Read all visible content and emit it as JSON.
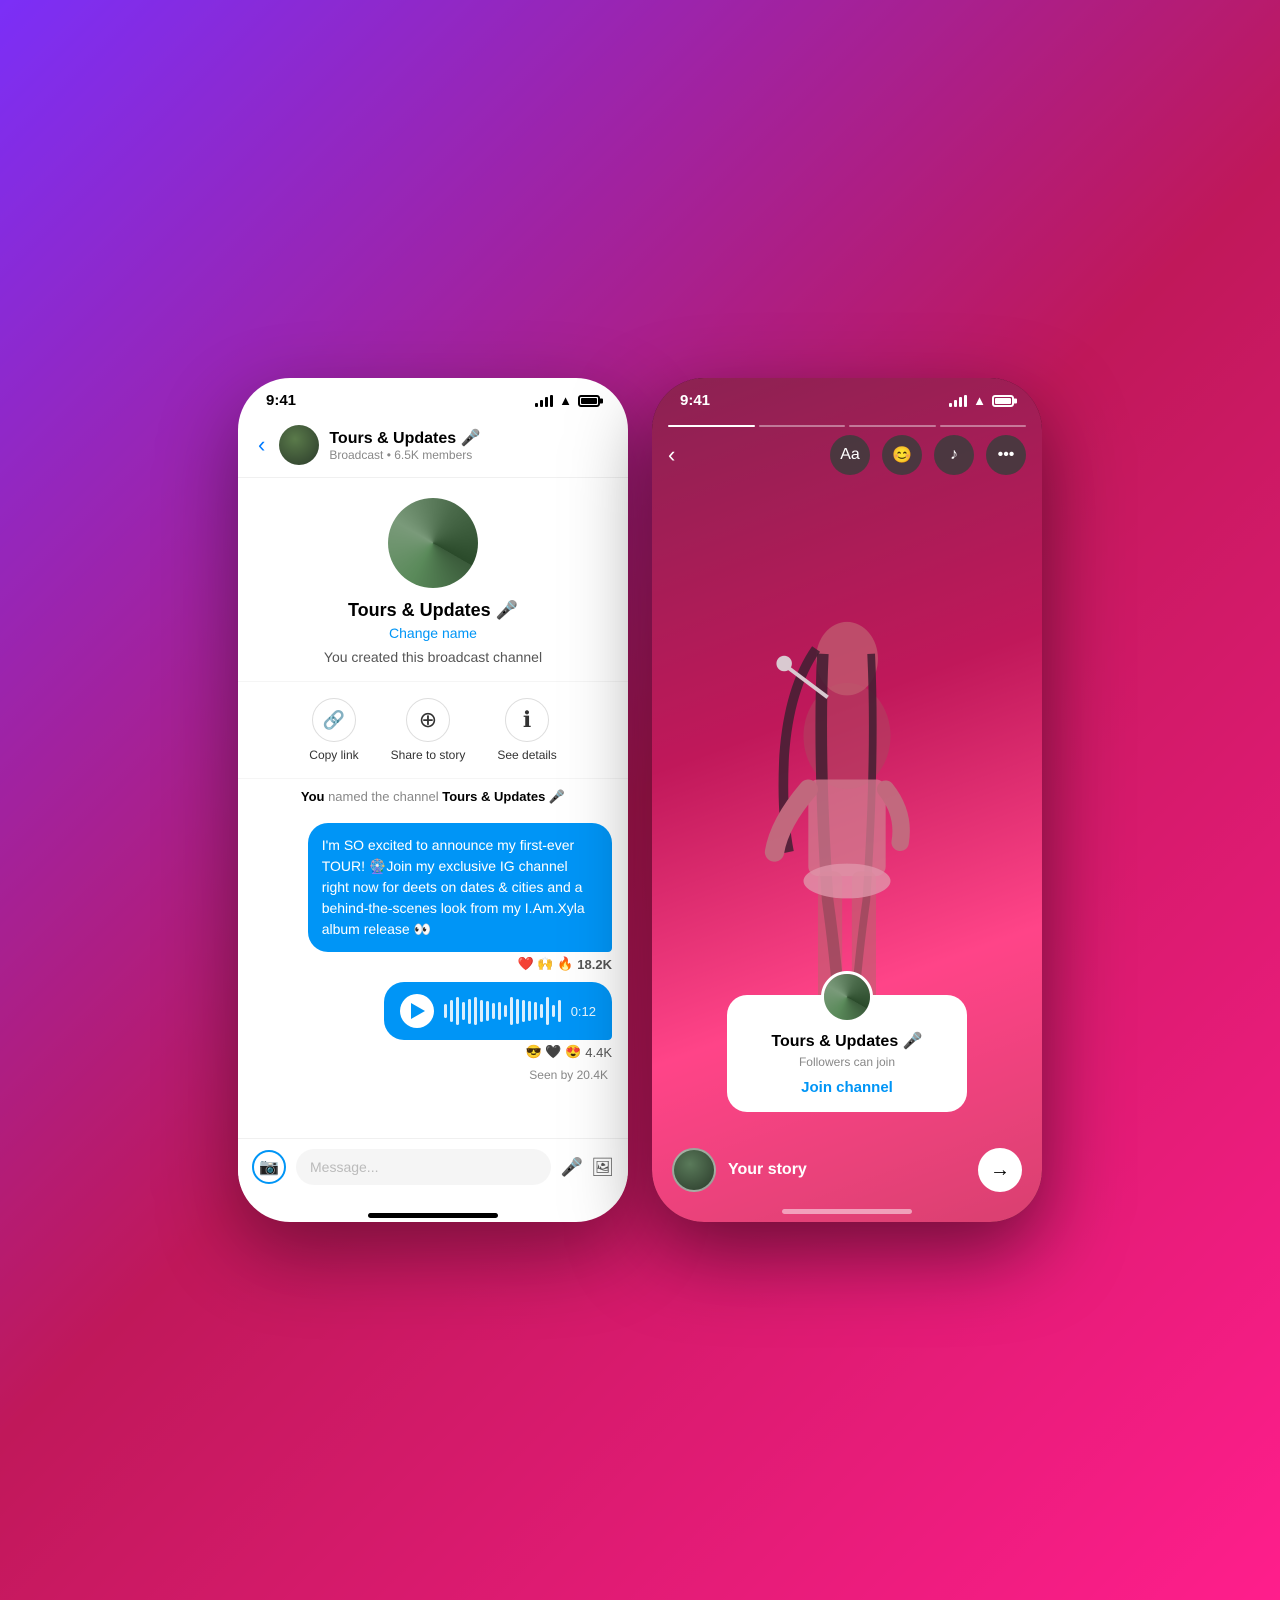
{
  "background": {
    "gradient": "linear-gradient(135deg, #7B2FF7, #C0185A, #FF1E8C)"
  },
  "phone_left": {
    "status": {
      "time": "9:41"
    },
    "header": {
      "back": "‹",
      "channel_name": "Tours & Updates 🎤",
      "subtitle": "Broadcast • 6.5K members"
    },
    "channel_profile": {
      "name": "Tours & Updates 🎤",
      "change_name": "Change name",
      "description": "You created this broadcast channel"
    },
    "actions": [
      {
        "id": "copy-link",
        "icon": "🔗",
        "label": "Copy link"
      },
      {
        "id": "share-story",
        "icon": "⊕",
        "label": "Share to story"
      },
      {
        "id": "see-details",
        "icon": "ⓘ",
        "label": "See details"
      }
    ],
    "system_message": {
      "prefix": "You",
      "text": " named the channel ",
      "channel": "Tours & Updates 🎤"
    },
    "message_bubble": {
      "text": "I'm SO excited to announce my first-ever TOUR! 🎡Join my exclusive IG channel right now for deets on dates & cities and a behind-the-scenes look from my I.Am.Xyla album release 👀",
      "reactions": "❤️ 🙌 🔥",
      "count": "18.2K"
    },
    "audio_message": {
      "duration": "0:12",
      "reactions": "😎 🖤 😍",
      "count": "4.4K"
    },
    "seen_by": "Seen by 20.4K",
    "input": {
      "placeholder": "Message..."
    }
  },
  "phone_right": {
    "status": {
      "time": "9:41"
    },
    "toolbar": {
      "back": "‹",
      "text_btn": "Aa",
      "emoji_btn": "😊",
      "music_btn": "♪",
      "more_btn": "•••"
    },
    "channel_card": {
      "name": "Tours & Updates 🎤",
      "subtitle": "Followers can join",
      "join_label": "Join channel"
    },
    "your_story": {
      "label": "Your story",
      "share_arrow": "→"
    },
    "progress_bars": [
      true,
      false,
      false,
      false
    ]
  }
}
